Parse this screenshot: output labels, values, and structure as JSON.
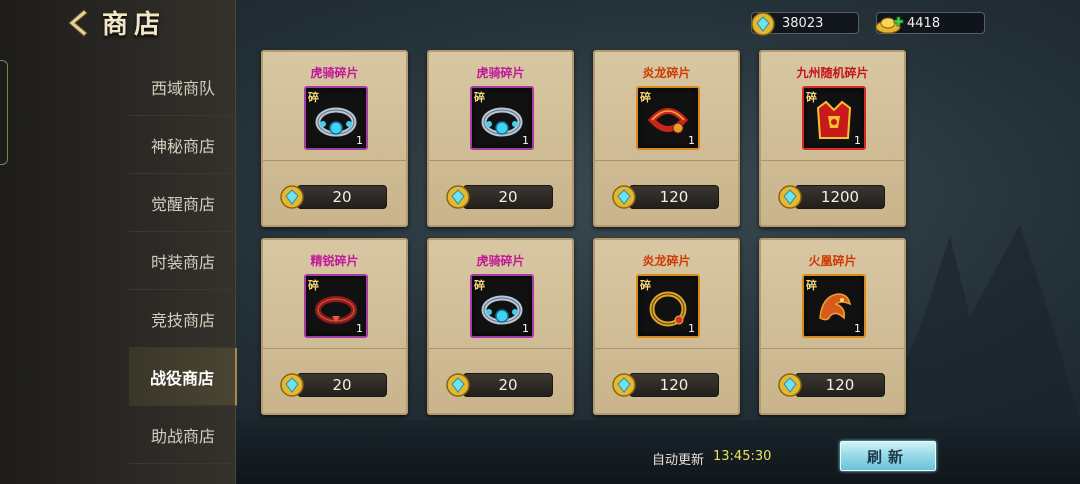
{
  "header": {
    "title": "商店"
  },
  "currencies": {
    "gems": {
      "value": "38023",
      "icon": "gem-coin-icon"
    },
    "gold": {
      "value": "4418",
      "icon": "gold-ingot-icon"
    }
  },
  "nav": {
    "items": [
      {
        "label": "西域商队",
        "active": false
      },
      {
        "label": "神秘商店",
        "active": false
      },
      {
        "label": "觉醒商店",
        "active": false
      },
      {
        "label": "时装商店",
        "active": false
      },
      {
        "label": "竞技商店",
        "active": false
      },
      {
        "label": "战役商店",
        "active": true
      },
      {
        "label": "助战商店",
        "active": false
      }
    ]
  },
  "shop": {
    "items": [
      {
        "name": "虎骑碎片",
        "badge": "碎",
        "count": "1",
        "price": "20",
        "rarity": "purple",
        "icon": "bracelet-blue-icon"
      },
      {
        "name": "虎骑碎片",
        "badge": "碎",
        "count": "1",
        "price": "20",
        "rarity": "purple",
        "icon": "bracelet-blue-icon"
      },
      {
        "name": "炎龙碎片",
        "badge": "碎",
        "count": "1",
        "price": "120",
        "rarity": "orange",
        "icon": "dragon-bracelet-icon"
      },
      {
        "name": "九州随机碎片",
        "badge": "碎",
        "count": "1",
        "price": "1200",
        "rarity": "red",
        "icon": "golden-armor-icon"
      },
      {
        "name": "精锐碎片",
        "badge": "碎",
        "count": "1",
        "price": "20",
        "rarity": "purple",
        "icon": "bracelet-red-icon"
      },
      {
        "name": "虎骑碎片",
        "badge": "碎",
        "count": "1",
        "price": "20",
        "rarity": "purple",
        "icon": "bracelet-blue-icon"
      },
      {
        "name": "炎龙碎片",
        "badge": "碎",
        "count": "1",
        "price": "120",
        "rarity": "orange",
        "icon": "gold-ring-icon"
      },
      {
        "name": "火凰碎片",
        "badge": "碎",
        "count": "1",
        "price": "120",
        "rarity": "orange",
        "icon": "phoenix-emblem-icon"
      }
    ]
  },
  "footer": {
    "refresh_label": "自动更新",
    "refresh_time": "13:45:30",
    "refresh_button": "刷新"
  },
  "colors": {
    "purple_name": "#c0189a",
    "orange_name": "#cf3a00",
    "red_name": "#c4141a",
    "timer": "#e8e35a",
    "refresh_button": "#8fd6e6"
  }
}
